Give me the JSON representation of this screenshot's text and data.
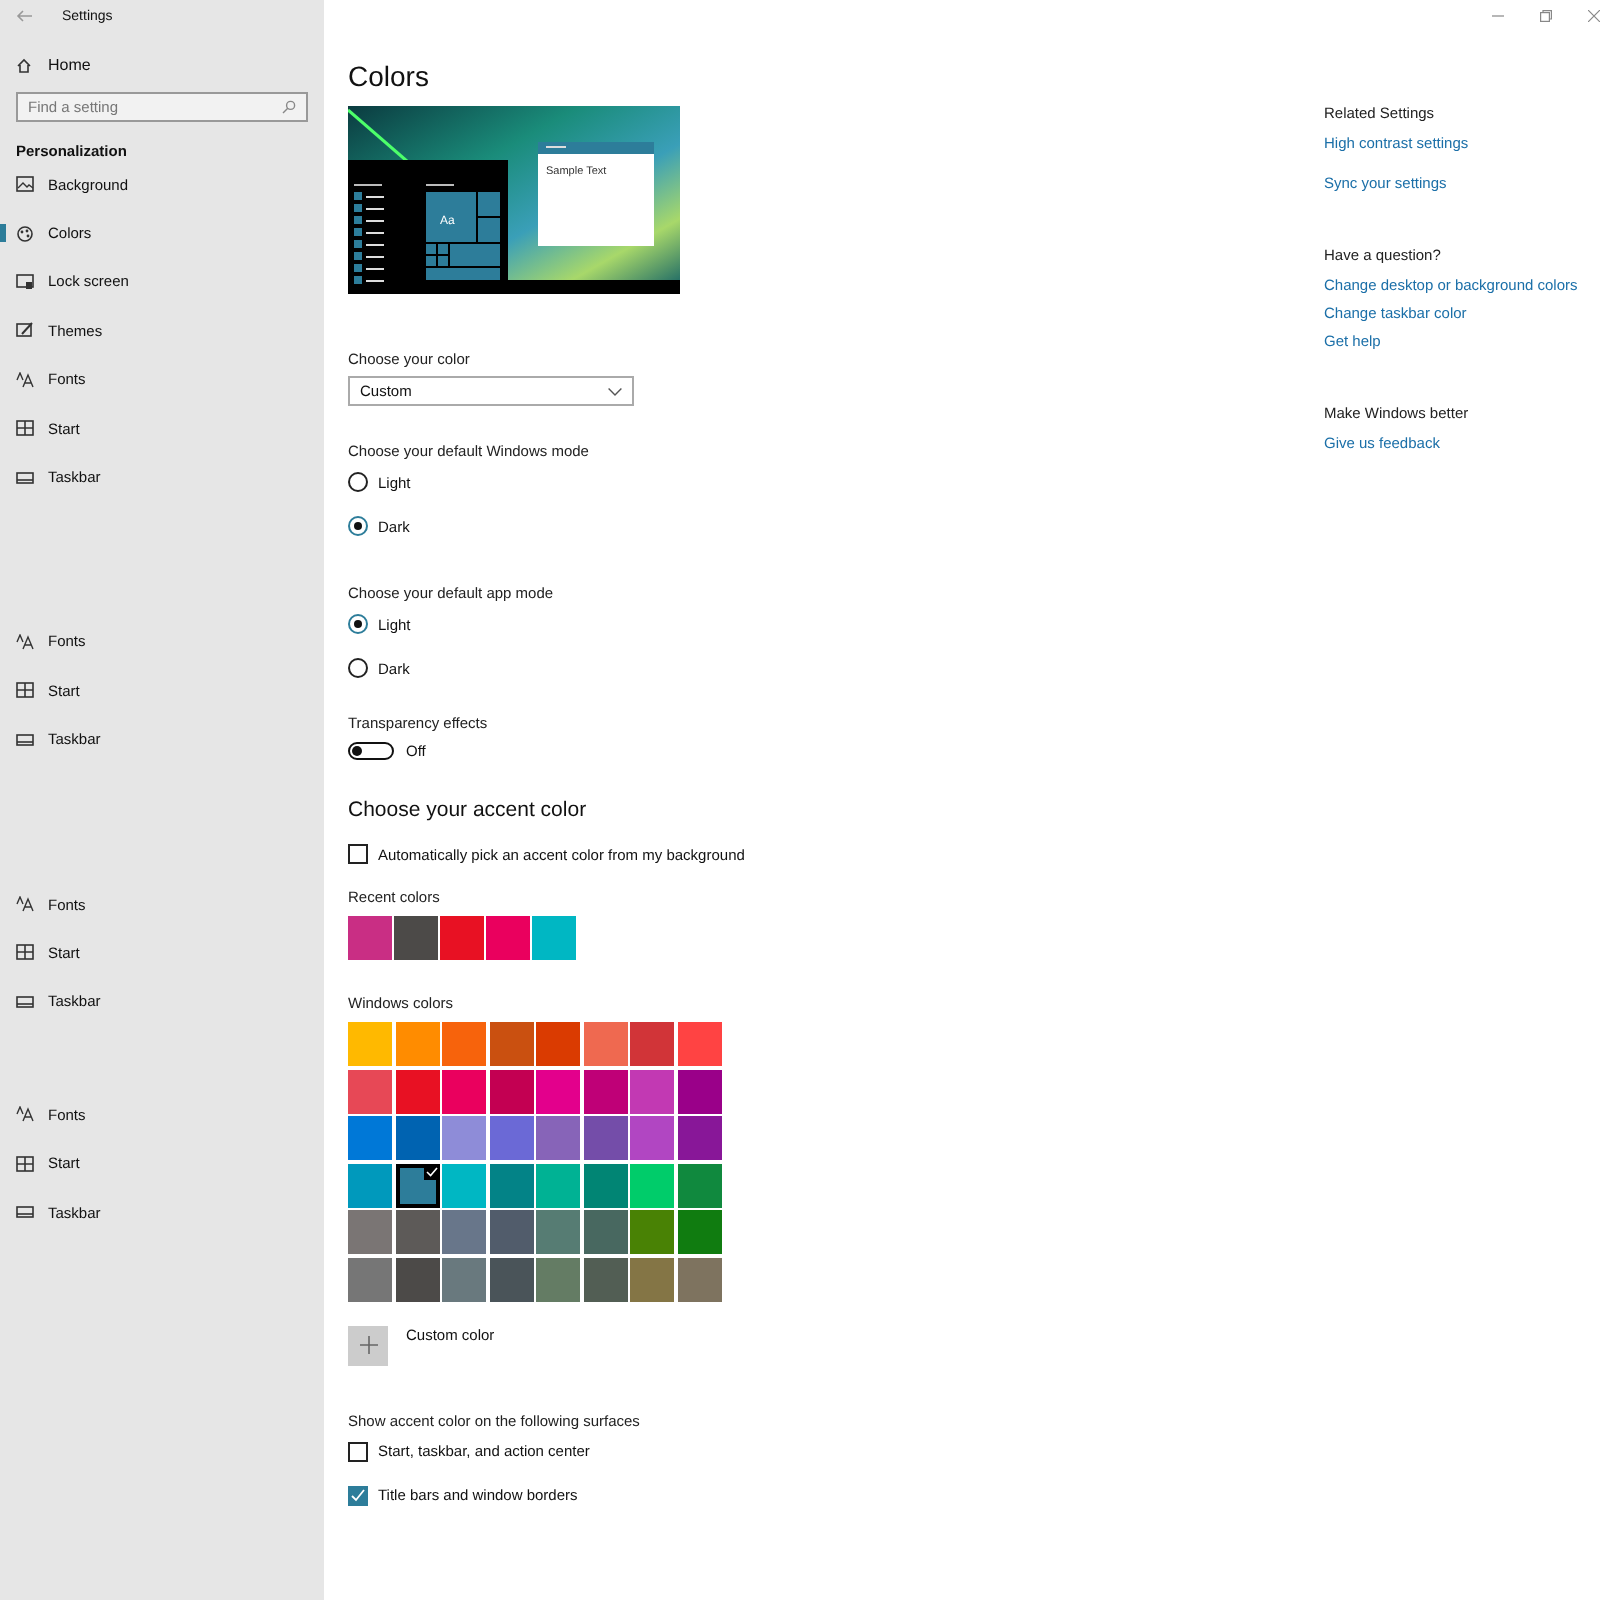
{
  "title_bar": {
    "title": "Settings"
  },
  "sidebar": {
    "home": "Home",
    "search": {
      "placeholder": "Find a setting"
    },
    "section": "Personalization",
    "groups": [
      {
        "items": [
          {
            "label": "Background",
            "kind": "background",
            "selected": false
          },
          {
            "label": "Colors",
            "kind": "colors",
            "selected": true
          },
          {
            "label": "Lock screen",
            "kind": "lock",
            "selected": false
          },
          {
            "label": "Themes",
            "kind": "themes",
            "selected": false
          },
          {
            "label": "Fonts",
            "kind": "fonts",
            "selected": false
          },
          {
            "label": "Start",
            "kind": "start",
            "selected": false
          },
          {
            "label": "Taskbar",
            "kind": "taskbar",
            "selected": false
          }
        ]
      },
      {
        "items": [
          {
            "label": "Fonts",
            "kind": "fonts",
            "selected": false
          },
          {
            "label": "Start",
            "kind": "start",
            "selected": false
          },
          {
            "label": "Taskbar",
            "kind": "taskbar",
            "selected": false
          }
        ]
      },
      {
        "items": [
          {
            "label": "Fonts",
            "kind": "fonts",
            "selected": false
          },
          {
            "label": "Start",
            "kind": "start",
            "selected": false
          },
          {
            "label": "Taskbar",
            "kind": "taskbar",
            "selected": false
          }
        ]
      },
      {
        "items": [
          {
            "label": "Fonts",
            "kind": "fonts",
            "selected": false
          },
          {
            "label": "Start",
            "kind": "start",
            "selected": false
          },
          {
            "label": "Taskbar",
            "kind": "taskbar",
            "selected": false
          }
        ]
      }
    ]
  },
  "main": {
    "title": "Colors",
    "preview": {
      "tile_text": "Aa",
      "sample_text": "Sample Text"
    },
    "color_choice": {
      "label": "Choose your color",
      "value": "Custom"
    },
    "windows_mode": {
      "label": "Choose your default Windows mode",
      "options": [
        {
          "label": "Light",
          "selected": false
        },
        {
          "label": "Dark",
          "selected": true
        }
      ]
    },
    "app_mode": {
      "label": "Choose your default app mode",
      "options": [
        {
          "label": "Light",
          "selected": true
        },
        {
          "label": "Dark",
          "selected": false
        }
      ]
    },
    "transparency": {
      "label": "Transparency effects",
      "on": false,
      "state_text": "Off"
    },
    "accent": {
      "heading": "Choose your accent color",
      "auto_pick": {
        "label": "Automatically pick an accent color from my background",
        "checked": false
      },
      "recent": {
        "label": "Recent colors",
        "swatches": [
          {
            "color": "#c92e84"
          },
          {
            "color": "#4c4a48"
          },
          {
            "color": "#e81123"
          },
          {
            "color": "#ea005e"
          },
          {
            "color": "#00b7c3"
          }
        ]
      },
      "windows": {
        "label": "Windows colors",
        "swatches": [
          {
            "color": "#ffb900",
            "selected": false
          },
          {
            "color": "#ff8c00",
            "selected": false
          },
          {
            "color": "#f7630c",
            "selected": false
          },
          {
            "color": "#ca5010",
            "selected": false
          },
          {
            "color": "#da3b01",
            "selected": false
          },
          {
            "color": "#ef6950",
            "selected": false
          },
          {
            "color": "#d13438",
            "selected": false
          },
          {
            "color": "#ff4343",
            "selected": false
          },
          {
            "color": "#e74856",
            "selected": false
          },
          {
            "color": "#e81123",
            "selected": false
          },
          {
            "color": "#ea005e",
            "selected": false
          },
          {
            "color": "#c30052",
            "selected": false
          },
          {
            "color": "#e3008c",
            "selected": false
          },
          {
            "color": "#bf0077",
            "selected": false
          },
          {
            "color": "#c239b3",
            "selected": false
          },
          {
            "color": "#9a0089",
            "selected": false
          },
          {
            "color": "#0078d7",
            "selected": false
          },
          {
            "color": "#0063b1",
            "selected": false
          },
          {
            "color": "#8e8cd8",
            "selected": false
          },
          {
            "color": "#6b69d6",
            "selected": false
          },
          {
            "color": "#8764b8",
            "selected": false
          },
          {
            "color": "#744da9",
            "selected": false
          },
          {
            "color": "#b146c2",
            "selected": false
          },
          {
            "color": "#881798",
            "selected": false
          },
          {
            "color": "#0099bc",
            "selected": false
          },
          {
            "color": "#2d7d9a",
            "selected": true
          },
          {
            "color": "#00b7c3",
            "selected": false
          },
          {
            "color": "#038387",
            "selected": false
          },
          {
            "color": "#00b294",
            "selected": false
          },
          {
            "color": "#018574",
            "selected": false
          },
          {
            "color": "#00cc6a",
            "selected": false
          },
          {
            "color": "#10893e",
            "selected": false
          },
          {
            "color": "#7a7574",
            "selected": false
          },
          {
            "color": "#5d5a58",
            "selected": false
          },
          {
            "color": "#68768a",
            "selected": false
          },
          {
            "color": "#515c6b",
            "selected": false
          },
          {
            "color": "#567c73",
            "selected": false
          },
          {
            "color": "#486860",
            "selected": false
          },
          {
            "color": "#498205",
            "selected": false
          },
          {
            "color": "#107c10",
            "selected": false
          },
          {
            "color": "#767676",
            "selected": false
          },
          {
            "color": "#4c4a48",
            "selected": false
          },
          {
            "color": "#69797e",
            "selected": false
          },
          {
            "color": "#4a5459",
            "selected": false
          },
          {
            "color": "#647c64",
            "selected": false
          },
          {
            "color": "#525e54",
            "selected": false
          },
          {
            "color": "#847545",
            "selected": false
          },
          {
            "color": "#7e735f",
            "selected": false
          }
        ]
      },
      "custom_color": "Custom color"
    },
    "surfaces": {
      "label": "Show accent color on the following surfaces",
      "options": [
        {
          "label": "Start, taskbar, and action center",
          "checked": false
        },
        {
          "label": "Title bars and window borders",
          "checked": true
        }
      ]
    }
  },
  "right": {
    "sections": [
      {
        "heading": "Related Settings",
        "links": [
          "High contrast settings",
          "Sync your settings"
        ]
      },
      {
        "heading": "Have a question?",
        "links": [
          "Change desktop or background colors",
          "Change taskbar color",
          "Get help"
        ]
      },
      {
        "heading": "Make Windows better",
        "links": [
          "Give us feedback"
        ]
      }
    ]
  }
}
